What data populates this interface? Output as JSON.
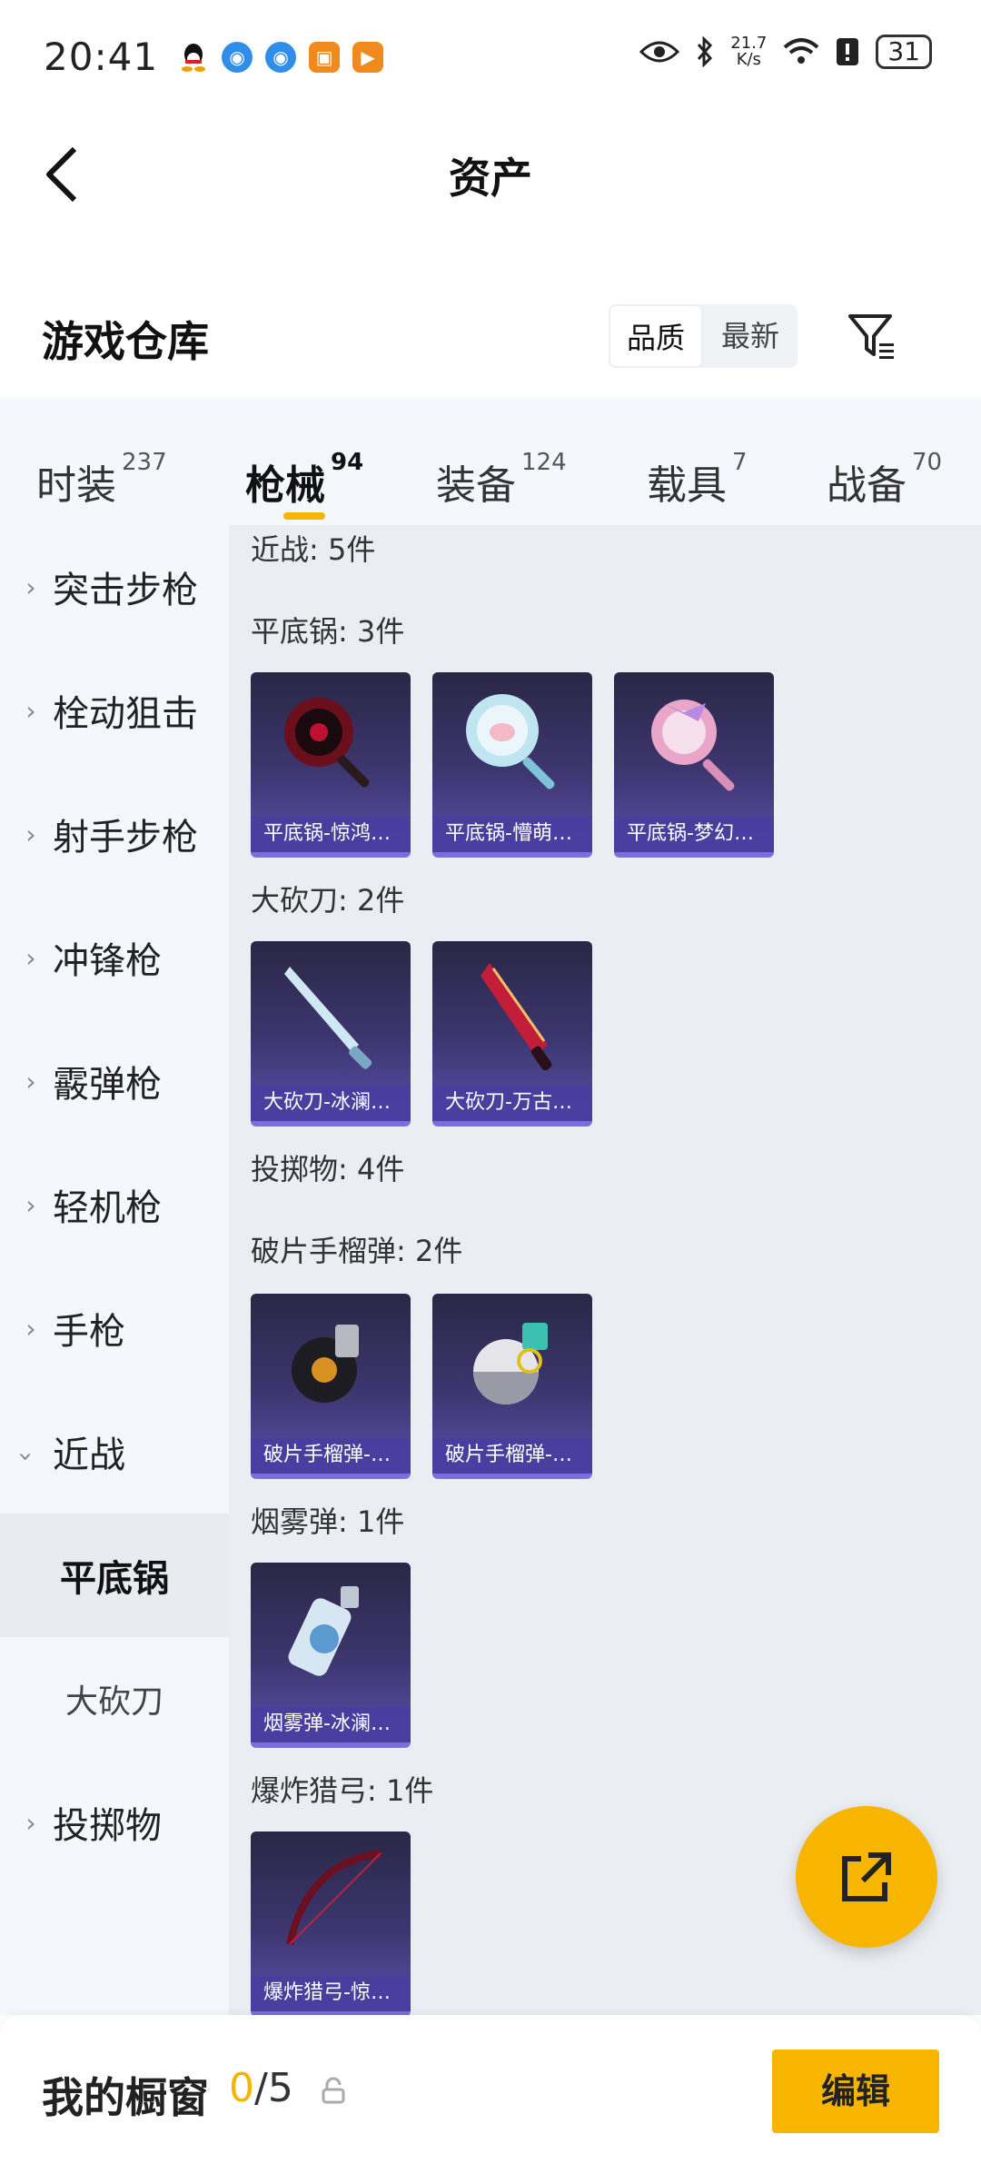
{
  "status_bar": {
    "time": "20:41",
    "network_speed_value": "21.7",
    "network_speed_unit": "K/s",
    "battery": "31"
  },
  "header": {
    "title": "资产"
  },
  "warehouse": {
    "title": "游戏仓库",
    "sort_quality": "品质",
    "sort_latest": "最新"
  },
  "tabs": [
    {
      "label": "时装",
      "count": "237"
    },
    {
      "label": "枪械",
      "count": "94"
    },
    {
      "label": "装备",
      "count": "124"
    },
    {
      "label": "载具",
      "count": "7"
    },
    {
      "label": "战备",
      "count": "70"
    }
  ],
  "sidebar": {
    "items": [
      {
        "label": "突击步枪"
      },
      {
        "label": "栓动狙击"
      },
      {
        "label": "射手步枪"
      },
      {
        "label": "冲锋枪"
      },
      {
        "label": "霰弹枪"
      },
      {
        "label": "轻机枪"
      },
      {
        "label": "手枪"
      },
      {
        "label": "近战"
      },
      {
        "label": "平底锅"
      },
      {
        "label": "大砍刀"
      },
      {
        "label": "投掷物"
      }
    ]
  },
  "content": {
    "melee_header": "近战: 5件",
    "pan_header": "平底锅: 3件",
    "pan_items": [
      "平底锅-惊鸿…",
      "平底锅-懵萌…",
      "平底锅-梦幻…"
    ],
    "machete_header": "大砍刀: 2件",
    "machete_items": [
      "大砍刀-冰澜…",
      "大砍刀-万古…"
    ],
    "throwable_header": "投掷物: 4件",
    "frag_header": "破片手榴弹: 2件",
    "frag_items": [
      "破片手榴弹-…",
      "破片手榴弹-…"
    ],
    "smoke_header": "烟雾弹: 1件",
    "smoke_items": [
      "烟雾弹-冰澜…"
    ],
    "bow_header": "爆炸猎弓: 1件",
    "bow_items": [
      "爆炸猎弓-惊…"
    ]
  },
  "bottom_bar": {
    "showcase_label": "我的橱窗",
    "showcase_current": "0",
    "showcase_total": "/5",
    "edit_label": "编辑"
  },
  "colors": {
    "accent": "#f7b500",
    "card_bg": "#3d3670",
    "card_border": "#7b6ee0"
  }
}
